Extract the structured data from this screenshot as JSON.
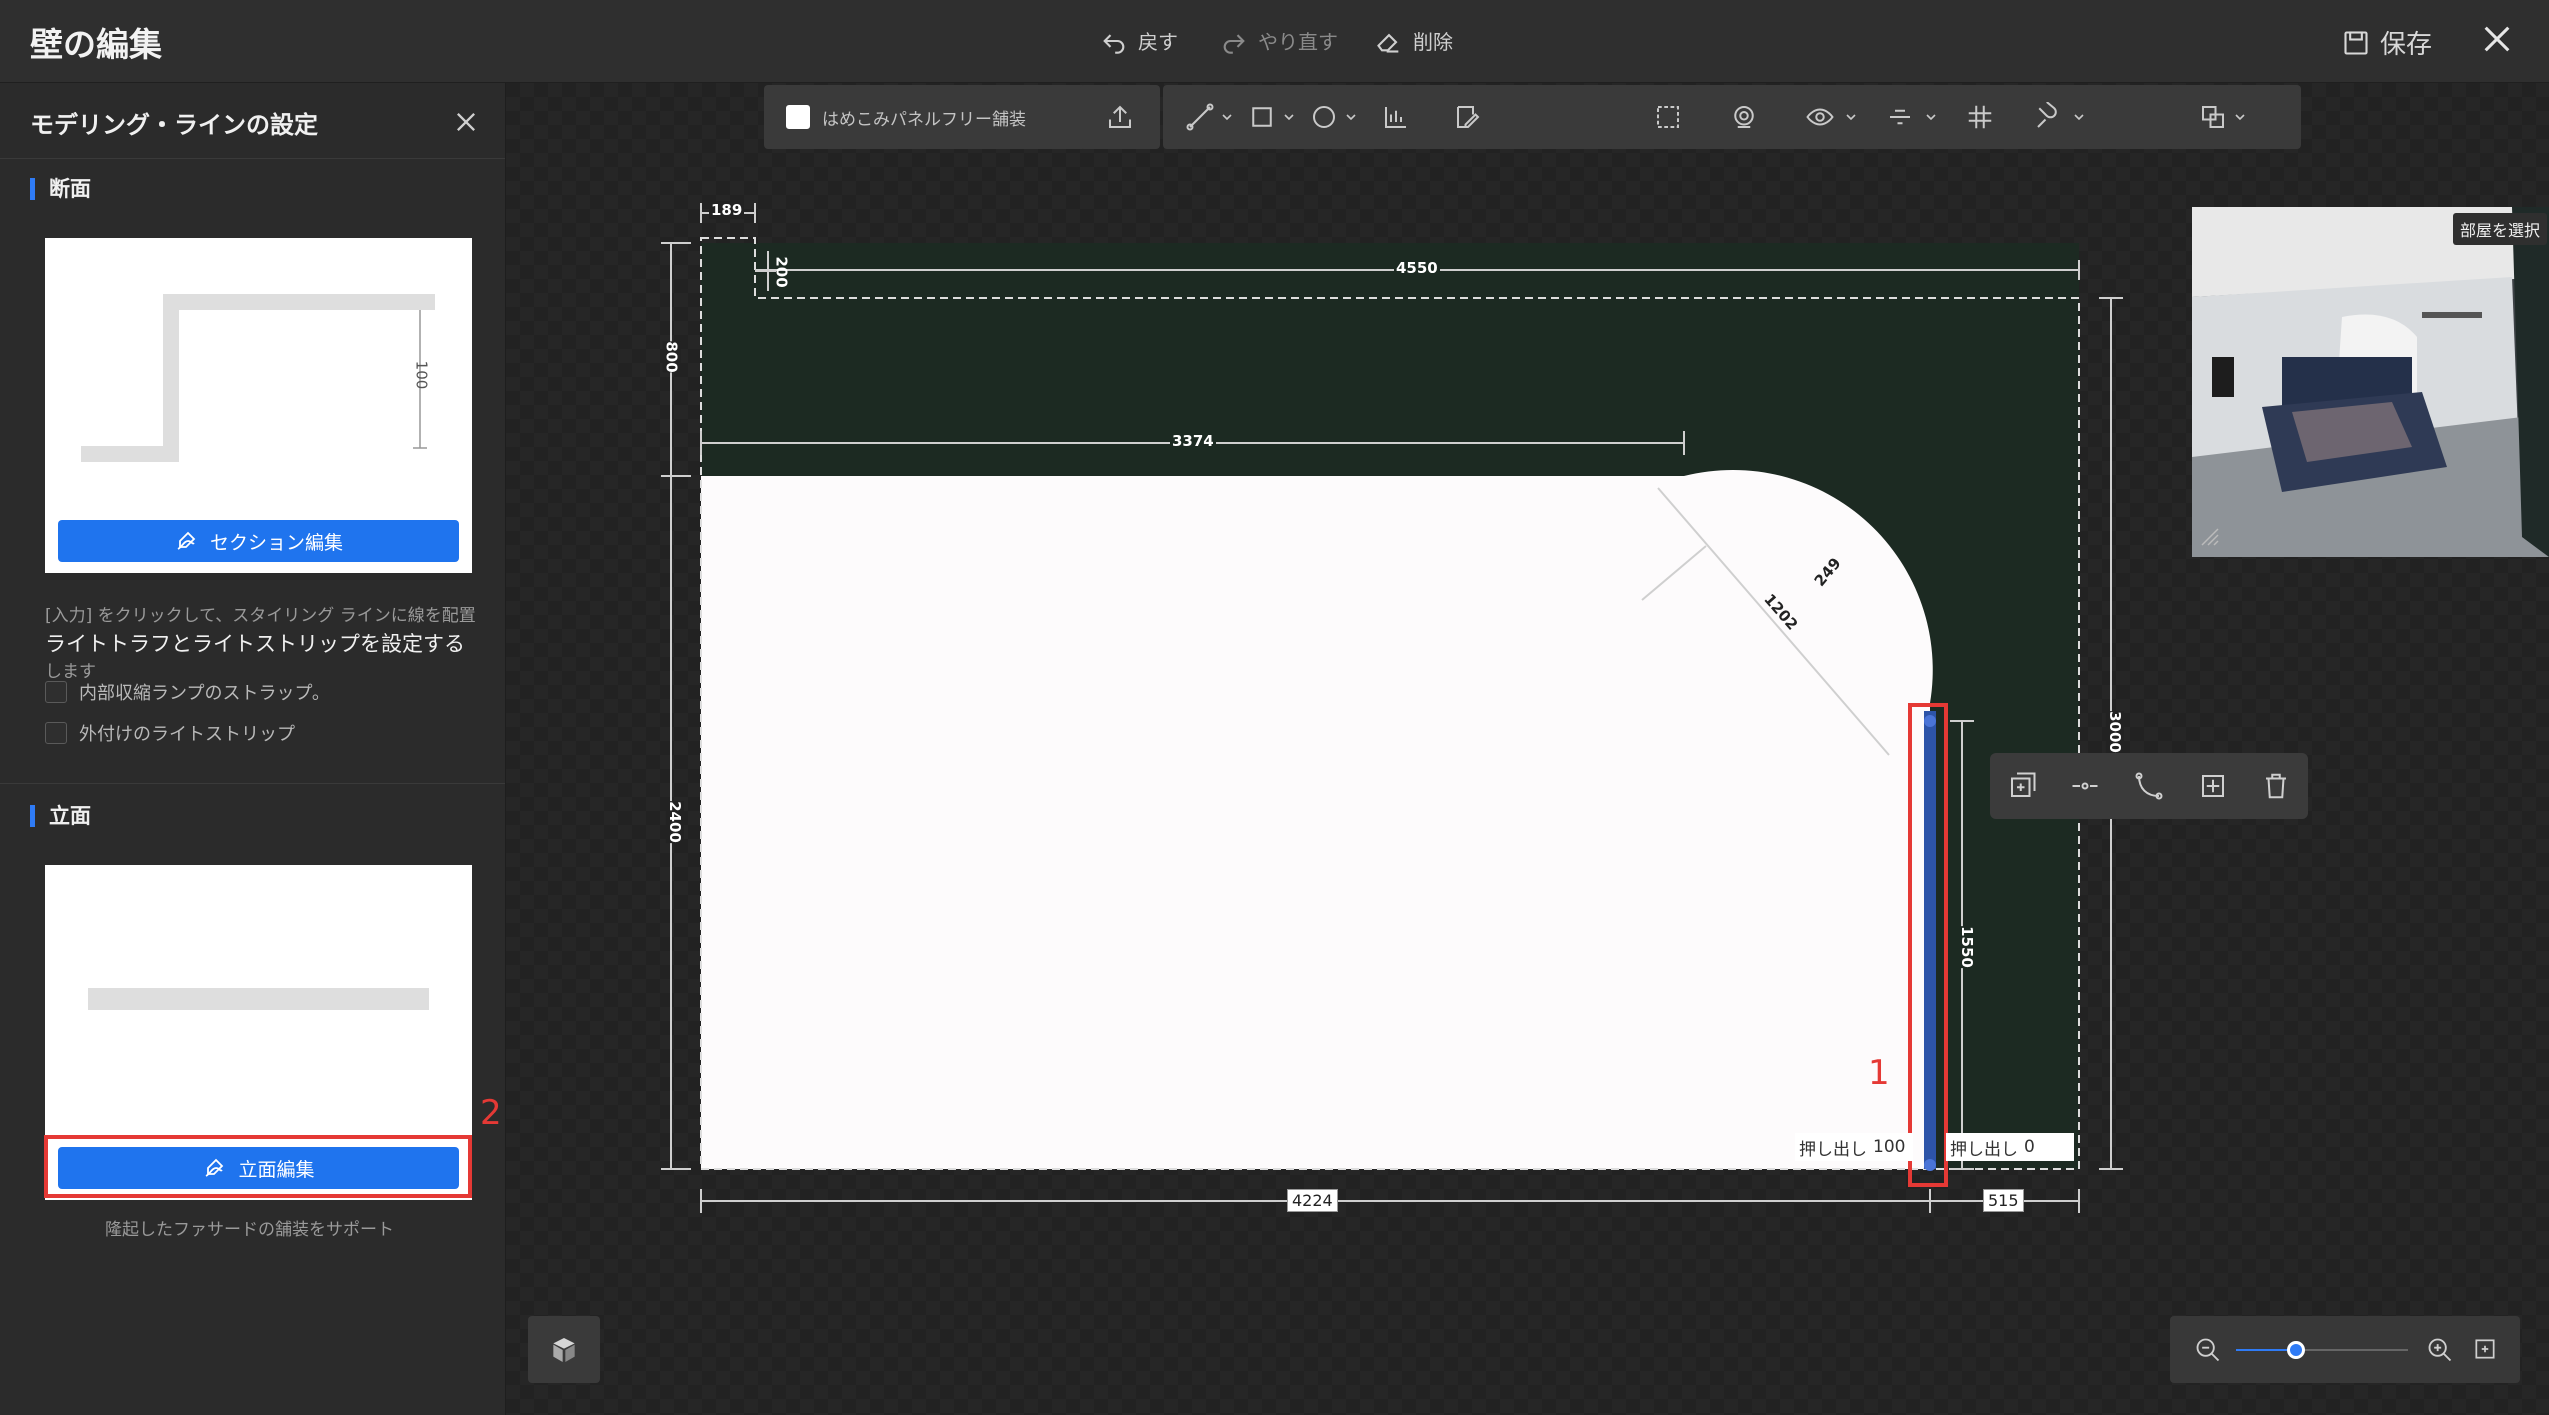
{
  "window": {
    "title": "壁の編集",
    "undo_label": "戻す",
    "redo_label": "やり直す",
    "delete_label": "削除",
    "save_label": "保存"
  },
  "panel": {
    "title": "モデリング・ラインの設定",
    "section_cross": {
      "title": "断面",
      "dimension": "100",
      "button_label": "セクション編集",
      "hint": "[入力] をクリックして、スタイリング ラインに線を配置します",
      "light_heading": "ライトトラフとライトストリップを設定する",
      "options": [
        {
          "label": "内部収縮ランプのストラップ。",
          "checked": false
        },
        {
          "label": "外付けのライトストリップ",
          "checked": false
        }
      ]
    },
    "section_elevation": {
      "title": "立面",
      "button_label": "立面編集",
      "hint": "隆起したファサードの舗装をサポート",
      "callout": "2"
    }
  },
  "toolbar": {
    "panel_free_label": "はめこみパネルフリー舗装",
    "panel_free_checked": false,
    "icons": [
      "upload-icon",
      "draw-line-icon",
      "rectangle-icon",
      "circle-icon",
      "dimension-icon",
      "edit-icon",
      "frame-select-icon",
      "lasso-icon",
      "eye-icon",
      "align-icon",
      "grid-icon",
      "magnet-icon",
      "layers-icon"
    ]
  },
  "plan": {
    "dimensions": {
      "top_left_notch": "189",
      "notch_depth": "200",
      "top_length": "4550",
      "left_upper": "800",
      "inner_top": "3374",
      "radius_small": "249",
      "radius_large": "1202",
      "left_height": "2400",
      "right_height": "3000",
      "wall_height": "1550",
      "bottom_length": "4224",
      "bottom_right": "515"
    },
    "extrude_left": "押し出し",
    "extrude_left_value": "100",
    "extrude_right": "押し出し",
    "extrude_right_value": "0",
    "callout": "1"
  },
  "preview": {
    "select_room_label": "部屋を選択"
  },
  "zoom": {
    "level": 0.35
  },
  "colors": {
    "accent": "#1f74ee",
    "wall": "#1c2a22",
    "highlight": "#e53935",
    "selected_wall": "#2d54a8"
  }
}
